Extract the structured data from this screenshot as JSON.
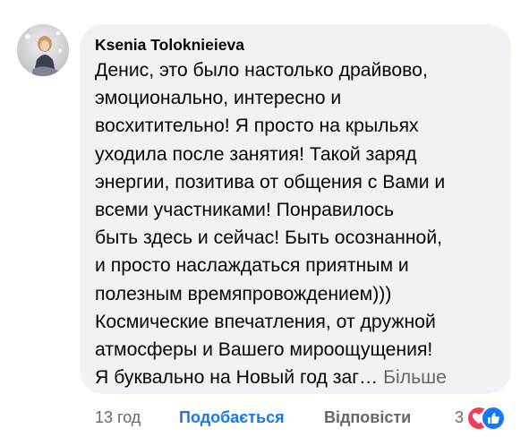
{
  "comment": {
    "author": "Ksenia Toloknieieva",
    "text": "Денис, это было настолько драйвово,\nэмоционально, интересно и\nвосхитительно! Я просто  на крыльях\nуходила после занятия! Такой заряд\nэнергии, позитива от общения с Вами и\nвсеми участниками! Понравилось\nбыть здесь и сейчас! Быть осознанной,\nи просто наслаждаться приятным и\nполезным времяпровождением)))\nКосмические впечатления, от дружной\nатмосферы и Вашего мироощущения!\nЯ буквально на Новый год заг… ",
    "see_more_label": "Більше",
    "avatar_icon": "user-avatar-photo"
  },
  "actions": {
    "time": "13 год",
    "like_label": "Подобається",
    "reply_label": "Відповісти",
    "reaction_count": "3",
    "reaction_icons": [
      "love-reaction-icon",
      "like-reaction-icon"
    ]
  },
  "colors": {
    "bubble_bg": "#f0f2f5",
    "like_active": "#1877f2",
    "secondary_text": "#65676b",
    "love_reaction": "#f33e58"
  }
}
